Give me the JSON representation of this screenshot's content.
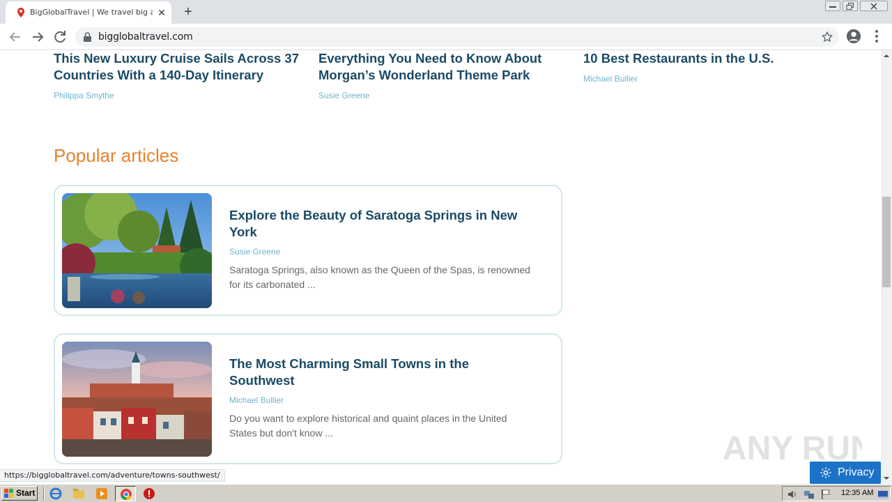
{
  "browser": {
    "tab_title": "BigGlobalTravel | We travel big and o",
    "url": "bigglobaltravel.com",
    "status_url": "https://bigglobaltravel.com/adventure/towns-southwest/"
  },
  "top_articles": [
    {
      "title": "This New Luxury Cruise Sails Across 37 Countries With a 140-Day Itinerary",
      "author": "Philippa Smythe"
    },
    {
      "title": "Everything You Need to Know About Morgan’s Wonderland Theme Park",
      "author": "Susie Greene"
    },
    {
      "title": "10 Best Restaurants in the U.S.",
      "author": "Michael Bullier"
    }
  ],
  "popular": {
    "heading": "Popular articles",
    "items": [
      {
        "title": "Explore the Beauty of Saratoga Springs in New York",
        "author": "Susie Greene",
        "excerpt": "Saratoga Springs, also known as the Queen of the Spas, is renowned for its carbonated ..."
      },
      {
        "title": "The Most Charming Small Towns in the Southwest",
        "author": "Michael Bullier",
        "excerpt": "Do you want to explore historical and quaint places in the United States but don't know ..."
      }
    ]
  },
  "privacy": {
    "label": "Privacy"
  },
  "watermark": {
    "text": "ANY RUN"
  },
  "taskbar": {
    "start_label": "Start",
    "clock": "12:35 AM"
  },
  "colors": {
    "heading": "#1b4a66",
    "author": "#6fb3cd",
    "section_title": "#e8812a",
    "card_border": "#d3e7eb",
    "privacy_bg": "#1a73c8"
  }
}
